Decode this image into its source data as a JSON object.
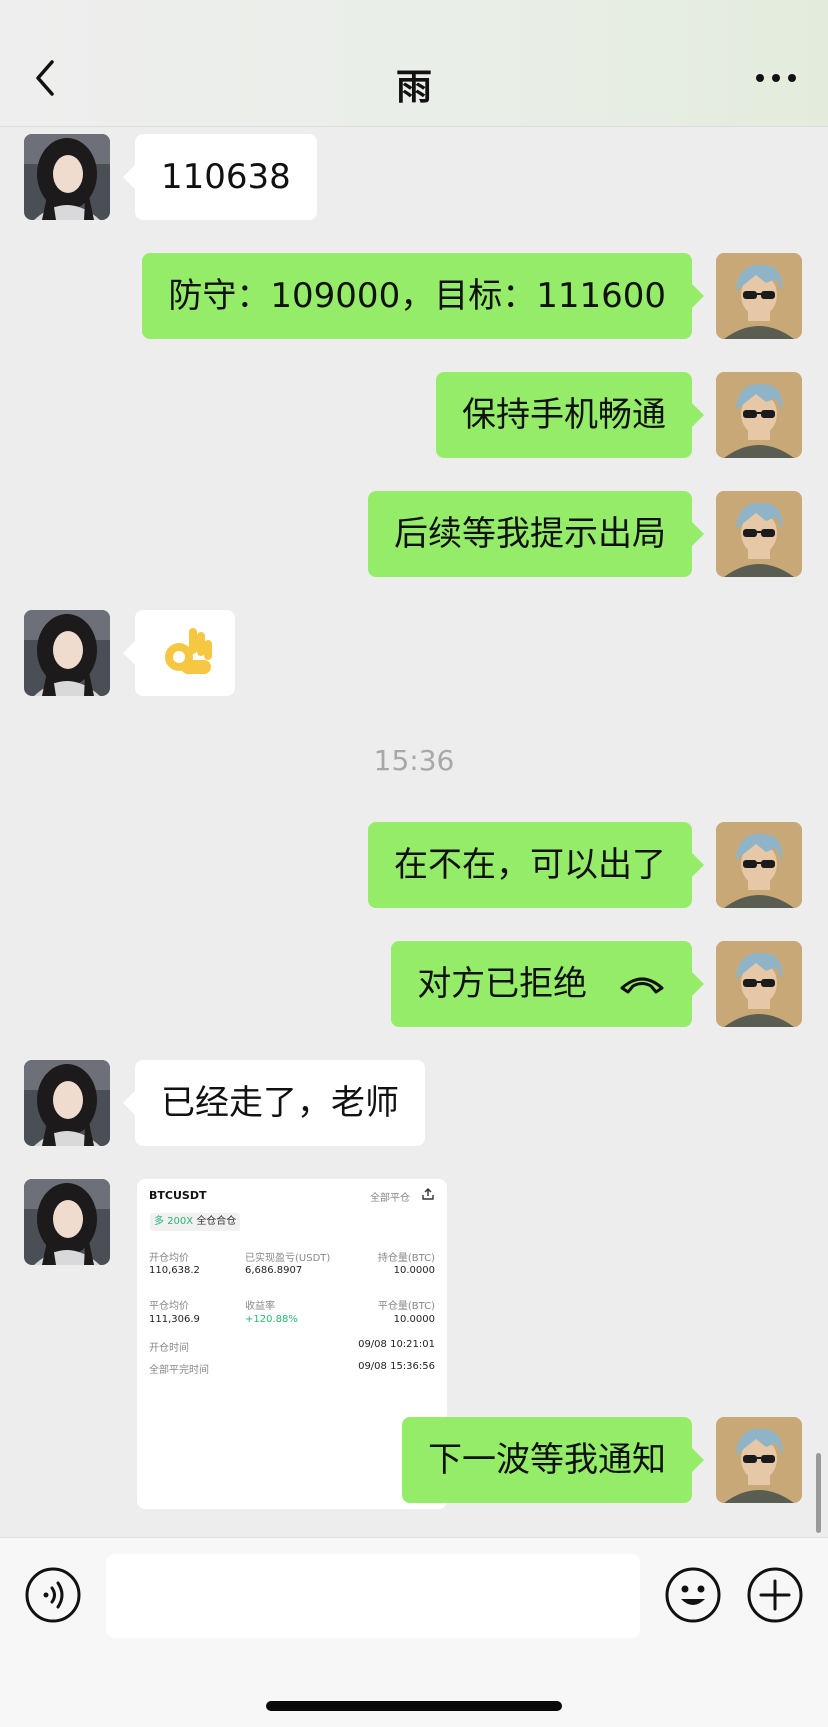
{
  "header": {
    "title": "雨",
    "back_icon": "chevron-left-icon",
    "more_icon": "more-horizontal-icon"
  },
  "messages": [
    {
      "side": "left",
      "type": "text",
      "text": "110638"
    },
    {
      "side": "right",
      "type": "text",
      "text": "防守：109000，目标：111600"
    },
    {
      "side": "right",
      "type": "text",
      "text": "保持手机畅通"
    },
    {
      "side": "right",
      "type": "text",
      "text": "后续等我提示出局"
    },
    {
      "side": "left",
      "type": "emoji",
      "text": "👌"
    },
    {
      "side": "right",
      "type": "text",
      "text": "在不在，可以出了"
    },
    {
      "side": "right",
      "type": "call",
      "text": "对方已拒绝",
      "icon": "phone-hangup-icon"
    },
    {
      "side": "left",
      "type": "text",
      "text": "已经走了，老师"
    },
    {
      "side": "right",
      "type": "text",
      "text": "下一波等我通知"
    }
  ],
  "timestamp": "15:36",
  "trade_card": {
    "symbol": "BTCUSDT",
    "close_all": "全部平仓",
    "share_icon": "share-icon",
    "tag_side": "多",
    "tag_leverage": "200X",
    "tag_mode": "全仓合仓",
    "open_avg_label": "开仓均价",
    "open_avg_value": "110,638.2",
    "realized_pnl_label": "已实现盈亏(USDT)",
    "realized_pnl_value": "6,686.8907",
    "position_label": "持仓量(BTC)",
    "position_value": "10.0000",
    "close_avg_label": "平仓均价",
    "close_avg_value": "111,306.9",
    "roi_label": "收益率",
    "roi_value": "+120.88%",
    "closed_qty_label": "平仓量(BTC)",
    "closed_qty_value": "10.0000",
    "open_time_label": "开仓时间",
    "open_time_value": "09/08 10:21:01",
    "close_time_label": "全部平完时间",
    "close_time_value": "09/08 15:36:56"
  },
  "bottombar": {
    "voice_icon": "voice-icon",
    "input_value": "",
    "emoji_icon": "emoji-icon",
    "plus_icon": "plus-circle-icon"
  },
  "colors": {
    "sent_bubble": "#95ec69",
    "received_bubble": "#ffffff",
    "background": "#ededed"
  }
}
